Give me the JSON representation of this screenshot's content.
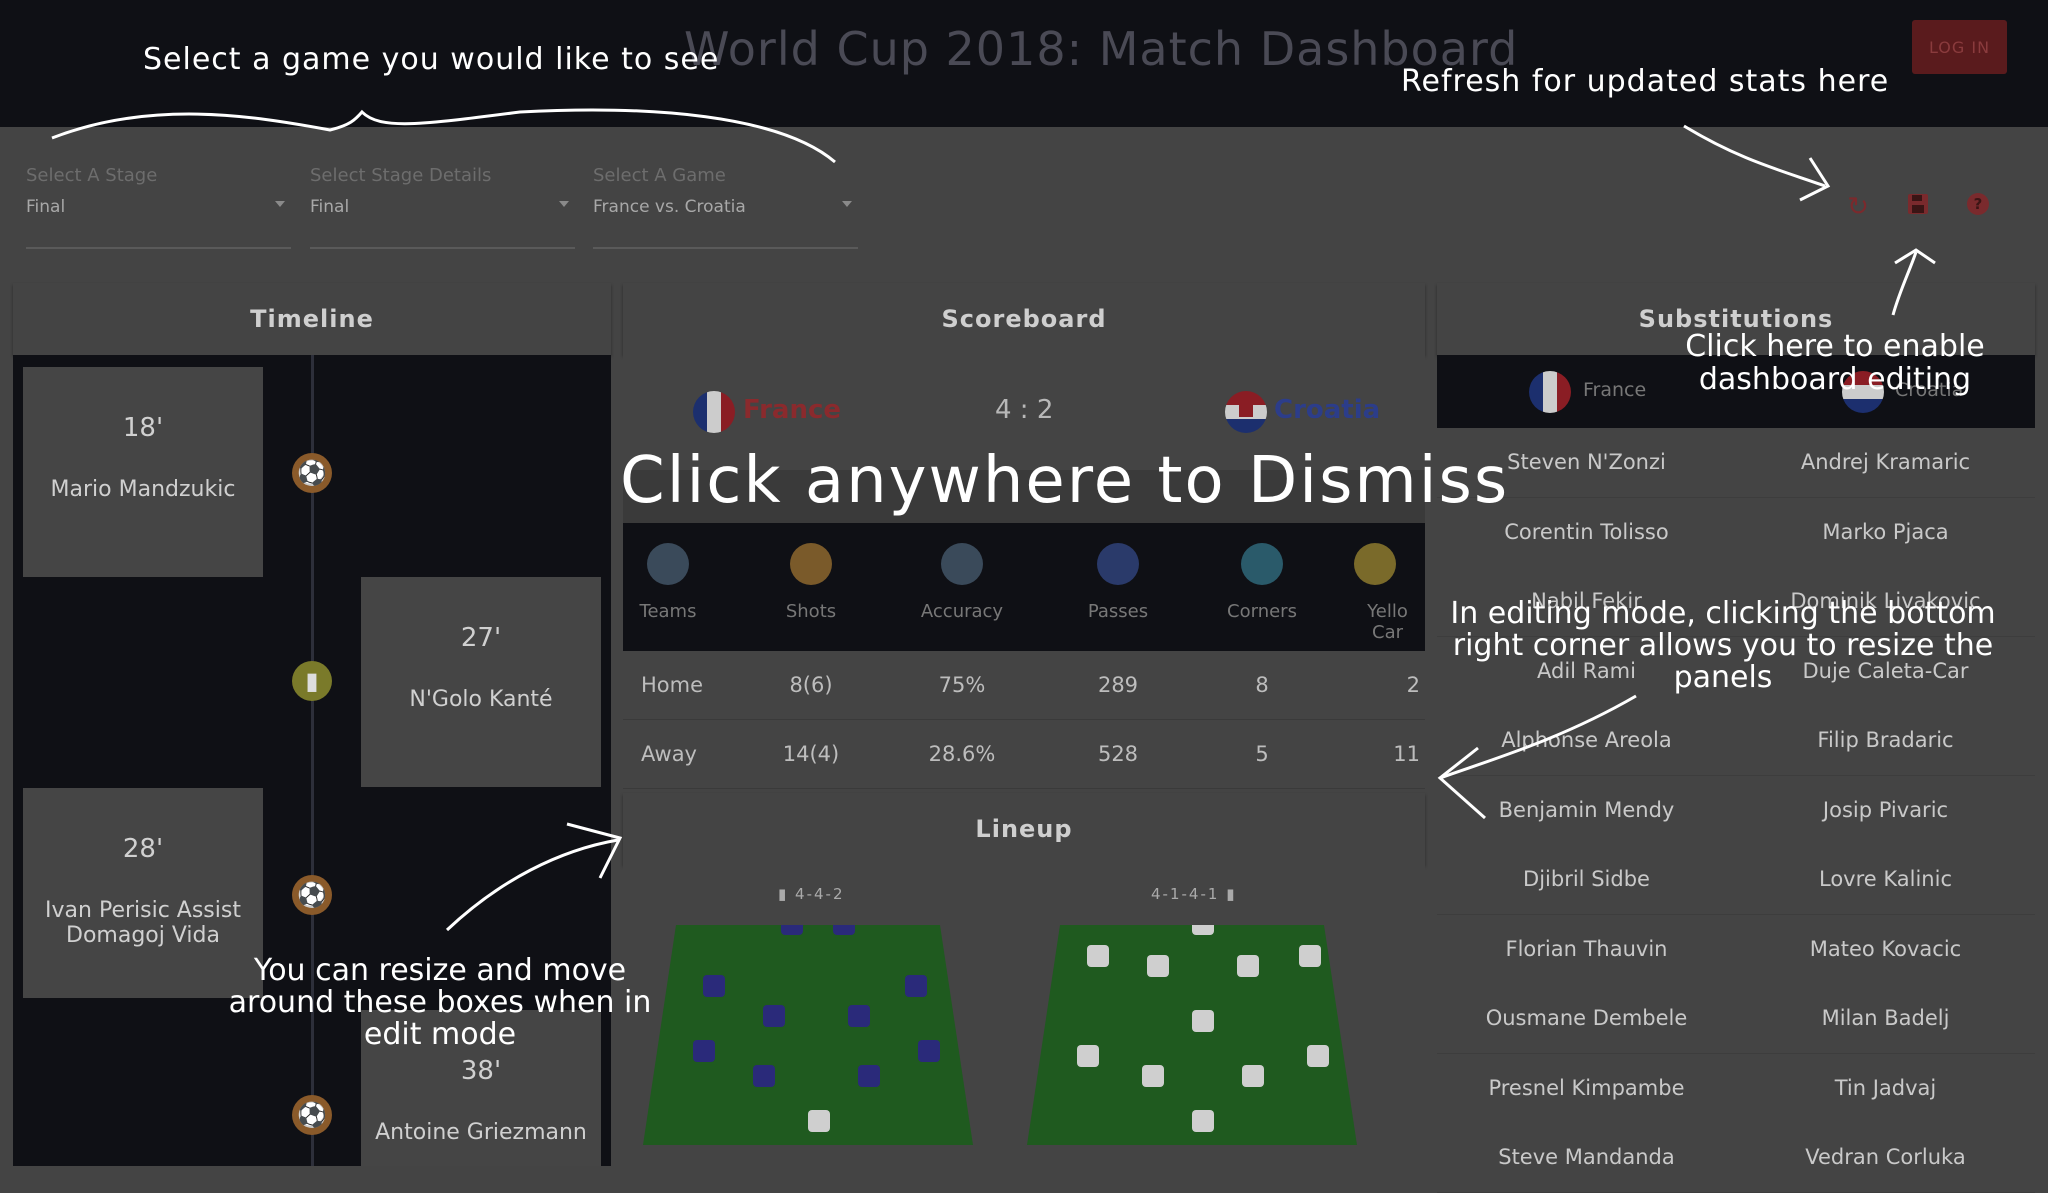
{
  "header": {
    "title": "World Cup 2018: Match Dashboard",
    "login_label": "LOG IN"
  },
  "filters": {
    "stage": {
      "label": "Select A Stage",
      "value": "Final"
    },
    "details": {
      "label": "Select Stage Details",
      "value": "Final"
    },
    "game": {
      "label": "Select A Game",
      "value": "France vs. Croatia"
    }
  },
  "toolbar": {
    "icons": [
      "refresh-icon",
      "save-icon",
      "help-icon"
    ],
    "accent": "#b33a3d"
  },
  "timeline": {
    "title": "Timeline",
    "events": [
      {
        "minute": "18'",
        "text": "Mario Mandzukic",
        "icon": "soccer-ball-icon",
        "side": "left"
      },
      {
        "minute": "27'",
        "text": "N'Golo Kanté",
        "icon": "yellow-card-icon",
        "side": "right"
      },
      {
        "minute": "28'",
        "text": "Ivan Perisic Assist Domagoj Vida",
        "icon": "soccer-ball-icon",
        "side": "left"
      },
      {
        "minute": "38'",
        "text": "Antoine Griezmann",
        "icon": "soccer-ball-icon",
        "side": "right"
      }
    ]
  },
  "scoreboard": {
    "title": "Scoreboard",
    "home": "France",
    "away": "Croatia",
    "score": "4 : 2",
    "columns": [
      "Teams",
      "Shots",
      "Accuracy",
      "Passes",
      "Corners",
      "Yello Car"
    ],
    "rows": [
      {
        "team": "Home",
        "shots": "8(6)",
        "accuracy": "75%",
        "passes": "289",
        "corners": "8",
        "yellow": "2"
      },
      {
        "team": "Away",
        "shots": "14(4)",
        "accuracy": "28.6%",
        "passes": "528",
        "corners": "5",
        "yellow": "11"
      }
    ]
  },
  "lineup": {
    "title": "Lineup",
    "home_formation": "4-4-2",
    "away_formation": "4-1-4-1"
  },
  "substitutions": {
    "title": "Substitutions",
    "tabs": [
      "France",
      "Croatia"
    ],
    "rows": [
      [
        "Steven N'Zonzi",
        "Andrej Kramaric"
      ],
      [
        "Corentin Tolisso",
        "Marko Pjaca"
      ],
      [
        "Nabil Fekir",
        "Dominik Livakovic"
      ],
      [
        "Adil Rami",
        "Duje Caleta-Car"
      ],
      [
        "Alphonse Areola",
        "Filip Bradaric"
      ],
      [
        "Benjamin Mendy",
        "Josip Pivaric"
      ],
      [
        "Djibril Sidbe",
        "Lovre Kalinic"
      ],
      [
        "Florian Thauvin",
        "Mateo Kovacic"
      ],
      [
        "Ousmane Dembele",
        "Milan Badelj"
      ],
      [
        "Presnel Kimpambe",
        "Tin Jadvaj"
      ],
      [
        "Steve Mandanda",
        "Vedran Corluka"
      ]
    ]
  },
  "tutorial": {
    "select_game": "Select a game you would like to see",
    "refresh": "Refresh for updated stats here",
    "edit": "Click here to enable dashboard editing",
    "dismiss": "Click anywhere to Dismiss",
    "resize_corner": "In editing mode, clicking the bottom right corner allows you to resize the panels",
    "move_boxes": "You can resize and move around these boxes when in edit mode"
  }
}
